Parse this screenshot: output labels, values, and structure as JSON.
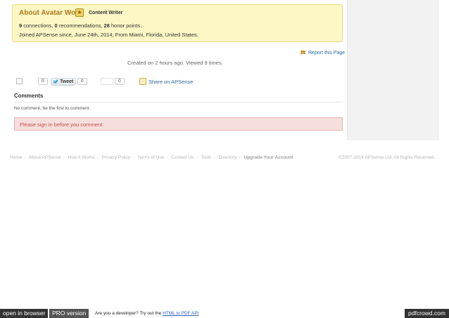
{
  "about": {
    "prefix": "About",
    "name": "Avatar Won",
    "role": "Content Writer",
    "connections": "9",
    "connections_label": "connections,",
    "recommendations": "0",
    "recommendations_label": "recommendations,",
    "honor": "28",
    "honor_label": "honor points.",
    "joined": "Joined APSense since, June 24th, 2014, From Miami, Florida, United States."
  },
  "report_label": "Report this Page",
  "created_text": "Created on 2 hours ago. Viewed 9 times.",
  "share": {
    "count_1": "0",
    "tweet_label": "Tweet",
    "count_2": "0",
    "count_3": "0",
    "share_label": "Share on APSense"
  },
  "comments": {
    "title": "Comments",
    "empty_text": "No comment, be the first to comment.",
    "signin_text": "Please sign in before you comment."
  },
  "footer": {
    "links": [
      "Home",
      "About APSense",
      "How it Works",
      "Privacy Policy",
      "Terms of Use",
      "Contact Us",
      "Tools",
      "Directory",
      "Upgrade Your Account"
    ],
    "separator": "-",
    "copyright": "©2007-2014 APSense Ltd. All Rights Reserved."
  },
  "pdfcrowd": {
    "open_label": "open in browser",
    "pro_label": "PRO version",
    "dev_text": "Are you a developer? Try out the",
    "dev_link": "HTML to PDF API",
    "brand": "pdfcrowd.com"
  },
  "colors": {
    "about_bg": "#fcf7c4",
    "link": "#2b6aa0",
    "alert_bg": "#f7dede",
    "alert_text": "#c0504d"
  }
}
